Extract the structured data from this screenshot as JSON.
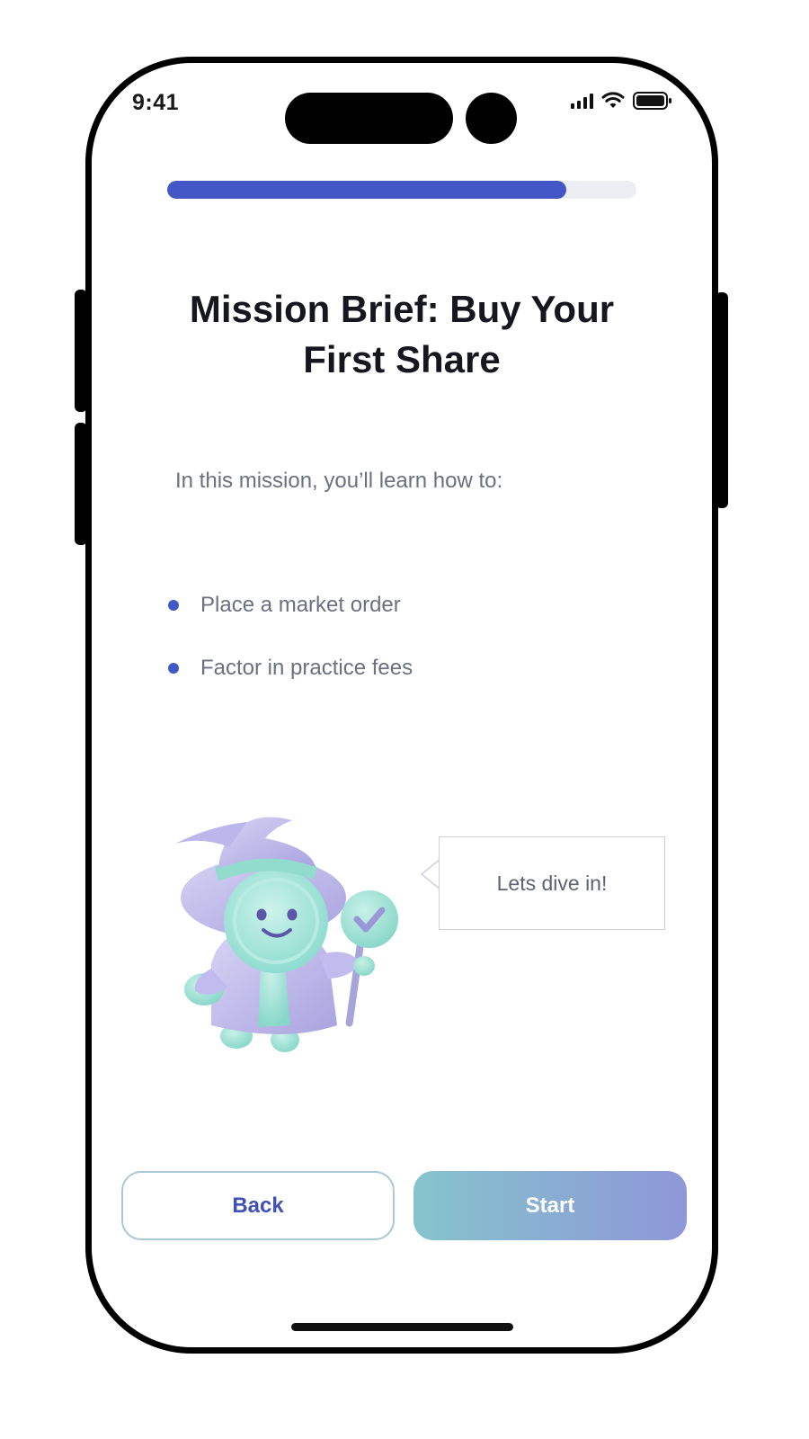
{
  "status_bar": {
    "time": "9:41",
    "icons": [
      "cellular-signal-icon",
      "wifi-icon",
      "battery-icon"
    ]
  },
  "progress": {
    "fraction": 0.85,
    "color": "#4457c6",
    "track_color": "#eceef3"
  },
  "mission": {
    "title": "Mission Brief: Buy Your First Share",
    "intro": "In this mission, you’ll learn how to:",
    "objectives": [
      "Place a market order",
      "Factor in practice fees"
    ]
  },
  "mascot": {
    "icon": "wizard-mascot-icon",
    "speech": "Lets dive in!"
  },
  "actions": {
    "back_label": "Back",
    "start_label": "Start"
  },
  "colors": {
    "accent": "#4457c6",
    "start_gradient_from": "#86c4cc",
    "start_gradient_to": "#8e97d8"
  }
}
